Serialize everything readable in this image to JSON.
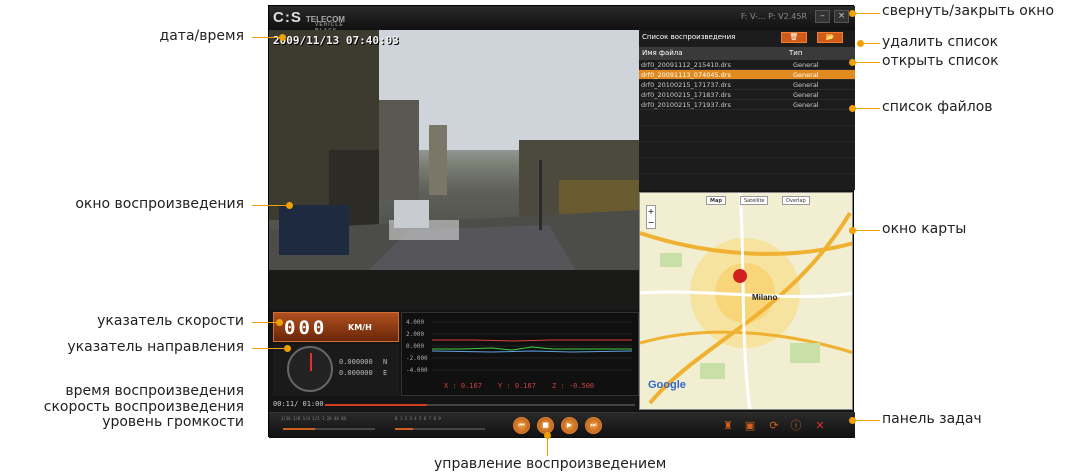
{
  "annotations": {
    "datetime": "дата/время",
    "playback_window": "окно воспроизведения",
    "speed_indicator": "указатель скорости",
    "direction_indicator": "указатель направления",
    "playback_time": "время воспроизведения",
    "playback_speed": "скорость воспроизведения",
    "volume_level": "уровень громкости",
    "minimize_close": "свернуть/закрыть окно",
    "delete_list": "удалить список",
    "open_list": "открыть список",
    "file_list": "список файлов",
    "map_window": "окно карты",
    "taskbar": "панель задач",
    "playback_control": "управление воспроизведением"
  },
  "app": {
    "logo": "C:S",
    "logo_brand": "TELECOM",
    "logo_sub": "VEHICLE BLACK BOX",
    "version": "F: V-... P: V2.45R",
    "timestamp": "2009/11/13 07:40:03",
    "speed_value": "000",
    "speed_unit": "KM/H",
    "gps_lat": "0.000000",
    "gps_lat_dir": "N",
    "gps_lon": "0.000000",
    "gps_lon_dir": "E",
    "time_readout": "00:11/ 01:00",
    "playback_progress": 0.33,
    "speed_ticks": "1/16 1/8 1/4 1/2 1 2X 4X 8X",
    "volume_ticks": "0 1 2 3 4 5 6 7 8 9",
    "speed_level": 0.35,
    "volume_level": 0.2
  },
  "graph": {
    "y_ticks": [
      "4.000",
      "2.000",
      "0.000",
      "-2.000",
      "-4.000"
    ],
    "x_readout": "X : 0.167",
    "y_readout": "Y : 0.167",
    "z_readout": "Z : -0.500"
  },
  "playlist": {
    "title": "Список воспроизведения",
    "col_name": "Имя файла",
    "col_type": "Тип",
    "rows": [
      {
        "name": "drf0_20091112_215410.drs",
        "type": "General"
      },
      {
        "name": "drf0_20091113_074045.drs",
        "type": "General"
      },
      {
        "name": "drf0_20100215_171737.drs",
        "type": "General"
      },
      {
        "name": "drf0_20100215_171837.drs",
        "type": "General"
      },
      {
        "name": "drf0_20100215_171937.drs",
        "type": "General"
      }
    ]
  },
  "map": {
    "tab_map": "Map",
    "tab_satellite": "Satellite",
    "tab_overlay": "Overlap",
    "city": "Milano",
    "attribution": "Google"
  },
  "colors": {
    "accent": "#f0a000",
    "orange": "#d05a18"
  }
}
